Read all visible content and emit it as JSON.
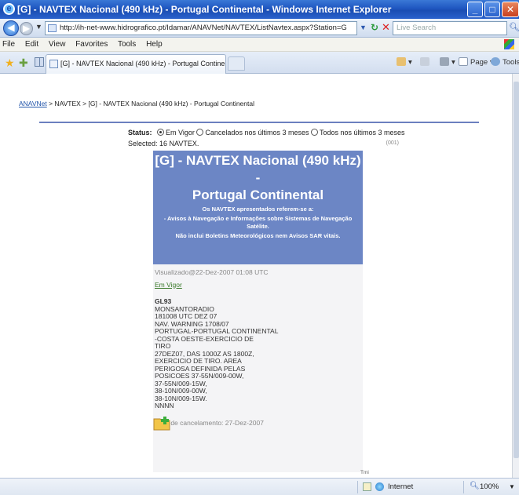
{
  "window": {
    "title": "[G] - NAVTEX Nacional (490 kHz) - Portugal Continental - Windows Internet Explorer"
  },
  "address_bar": {
    "url": "http://ih-net-www.hidrografico.pt/Idamar/ANAVNet/NAVTEX/ListNavtex.aspx?Station=G",
    "search_placeholder": "Live Search"
  },
  "menu": [
    "File",
    "Edit",
    "View",
    "Favorites",
    "Tools",
    "Help"
  ],
  "tabs": [
    {
      "label": "[G] - NAVTEX Nacional (490 kHz) - Portugal Continental"
    }
  ],
  "command_bar": {
    "page_label": "Page",
    "tools_label": "Tools"
  },
  "page": {
    "breadcrumb": {
      "root": "ANAVNet",
      "rest": " > NAVTEX > [G] - NAVTEX Nacional (490 kHz) - Portugal Continental"
    },
    "status": {
      "label": "Status:",
      "options": [
        "Em Vigor",
        "Cancelados nos últimos 3 meses",
        "Todos nos últimos 3 meses"
      ],
      "selected_index": 0
    },
    "selected_text": "Selected: 16 NAVTEX.",
    "selected_count_code": "(001)",
    "panel": {
      "title_line1": "[G] - NAVTEX Nacional (490 kHz) -",
      "title_line2": "Portugal Continental",
      "note_line1": "Os NAVTEX apresentados referem-se a:",
      "note_line2": "- Avisos à Navegação e Informações sobre Sistemas de Navegação Satélite.",
      "note_line3": "Não inclui Boletins Meteorológicos nem Avisos SAR vitais."
    },
    "message": {
      "viewed": "Visualizado@22-Dez-2007 01:08 UTC",
      "status_link": "Em Vigor",
      "id": "GL93",
      "lines": [
        "MONSANTORADIO",
        "181008 UTC DEZ 07",
        "NAV. WARNING 1708/07",
        "PORTUGAL-PORTUGAL CONTINENTAL",
        "-COSTA OESTE-EXERCICIO DE",
        "TIRO",
        "27DEZ07, DAS 1000Z AS 1800Z,",
        "EXERCICIO DE TIRO. AREA",
        "PERIGOSA DEFINIDA PELAS",
        "POSICOES 37-55N/009-00W,",
        "37-55N/009-15W,",
        "38-10N/009-00W,",
        "38-10N/009-15W.",
        "NNNN"
      ],
      "cancel_date": "Data de cancelamento: 27-Dez-2007"
    },
    "footer_mark": "Tmi"
  },
  "status_bar": {
    "zone": "Internet",
    "zoom": "100%"
  }
}
